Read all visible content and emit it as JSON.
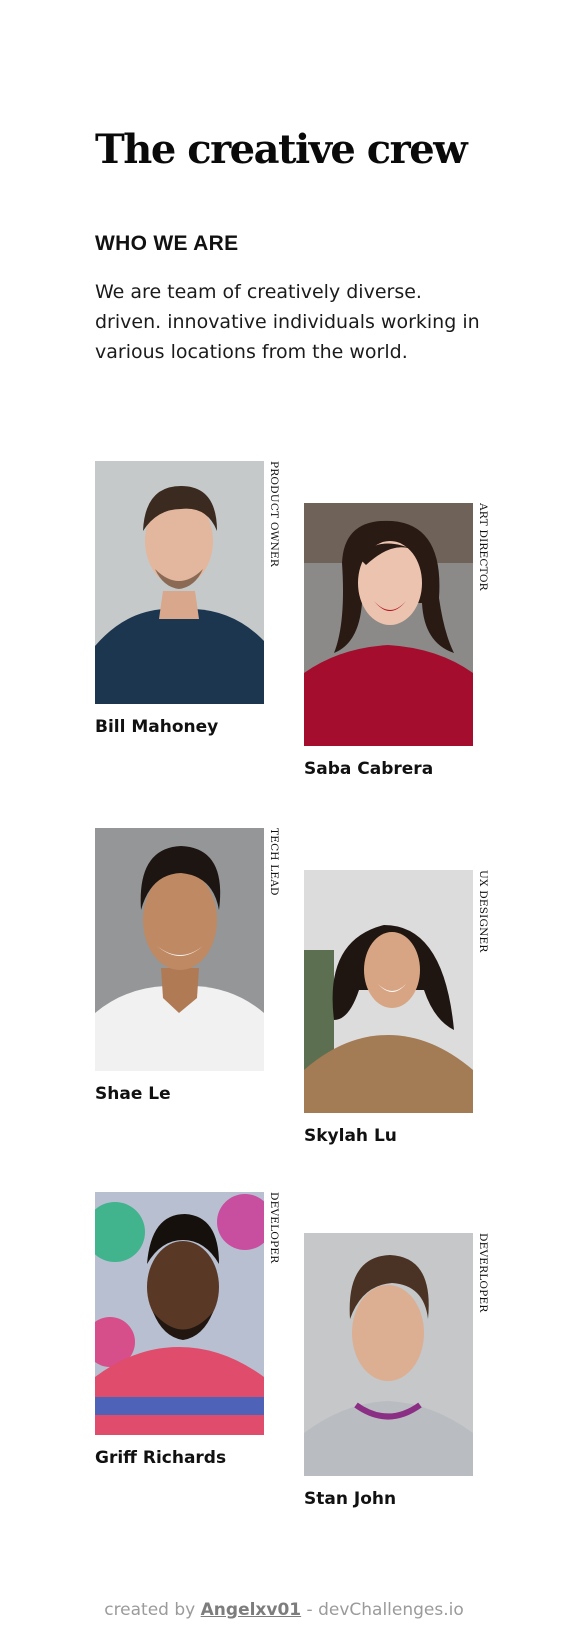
{
  "page": {
    "title": "The creative crew",
    "section_heading": "WHO WE ARE",
    "intro": "We are team of creatively diverse. driven. innovative individuals working in various locations from the world."
  },
  "members": [
    {
      "name": "Bill Mahoney",
      "role": "PRODUCT OWNER"
    },
    {
      "name": "Saba Cabrera",
      "role": "ART DIRECTOR"
    },
    {
      "name": "Shae Le",
      "role": "TECH LEAD"
    },
    {
      "name": "Skylah Lu",
      "role": "UX DESIGNER"
    },
    {
      "name": "Griff Richards",
      "role": "DEVELOPER"
    },
    {
      "name": "Stan John",
      "role": "DEVERLOPER"
    }
  ],
  "footer": {
    "prefix": "created by",
    "author": "Angelxv01",
    "suffix": "- devChallenges.io"
  },
  "colors": {
    "background": "#ffffff",
    "text": "#111111",
    "footer_text": "#9b9b9b"
  }
}
